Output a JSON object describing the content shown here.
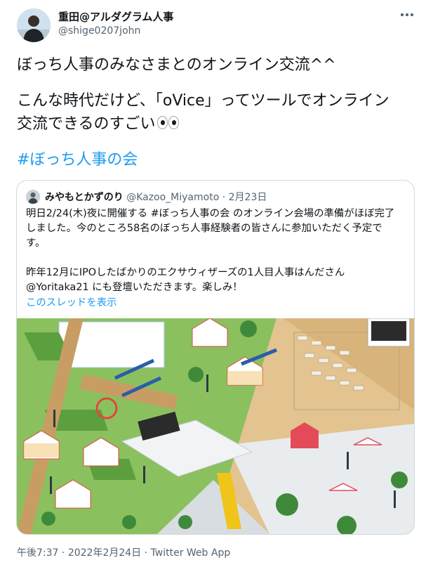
{
  "author": {
    "name": "重田@アルダグラム人事",
    "handle": "@shige0207john"
  },
  "tweet": {
    "line1": "ぼっち人事のみなさまとのオンライン交流^^",
    "line2": "こんな時代だけど、「oVice」ってツールでオンライン",
    "line3": "交流できるのすごい",
    "emoji": "eyes",
    "hashtag": "#ぼっち人事の会"
  },
  "quoted": {
    "name": "みやもとかずのり",
    "handle": "@Kazoo_Miyamoto",
    "separator": "·",
    "date": "2月23日",
    "text_lines": [
      "明日2/24(木)夜に開催する #ぼっち人事の会 のオンライン会場の準備がほぼ完了",
      "しました。今のところ58名のぼっち人事経験者の皆さんに参加いただく予定で",
      "す。",
      "",
      "昨年12月にIPOしたばかりのエクサウィザーズの1人目人事はんださん",
      "@Yoritaka21 にも登壇いただきます。楽しみ！"
    ],
    "thread_link": "このスレッドを表示"
  },
  "footer": {
    "time": "午後7:37",
    "separator1": "·",
    "date": "2022年2月24日",
    "separator2": "·",
    "source": "Twitter Web App"
  },
  "colors": {
    "link": "#1d9bf0",
    "text": "#0f1419",
    "muted": "#536471",
    "border": "#cfd9de",
    "map_grass": "#8bc05f",
    "map_sand": "#e3c38f",
    "map_floor": "#e9ecef"
  }
}
